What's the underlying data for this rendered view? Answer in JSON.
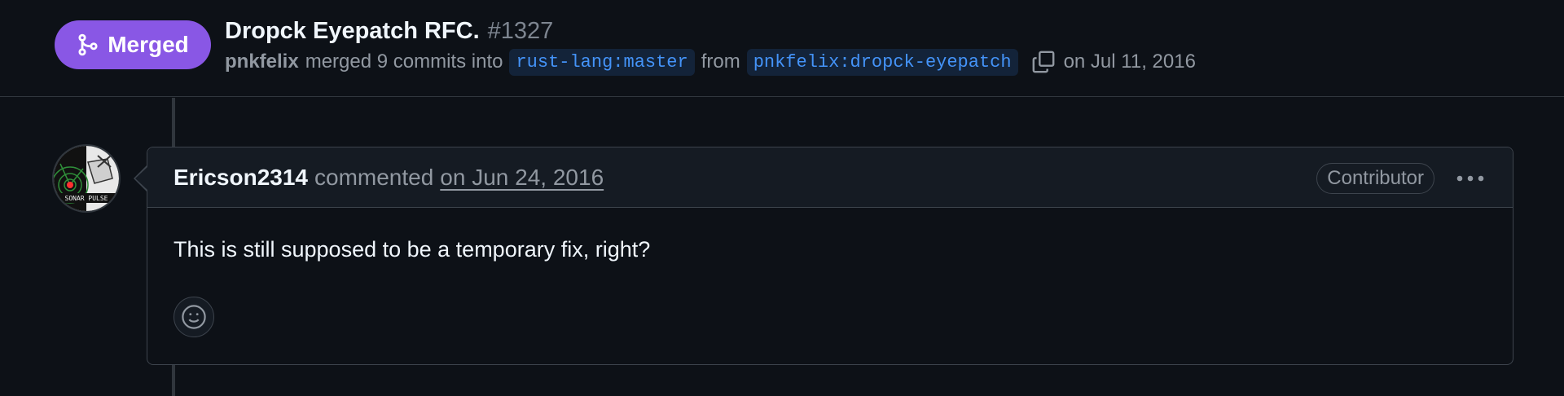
{
  "pr": {
    "state_label": "Merged",
    "title": "Dropck Eyepatch RFC.",
    "number": "#1327",
    "merger": "pnkfelix",
    "merge_text": "merged 9 commits into",
    "base_branch": "rust-lang:master",
    "from_text": "from",
    "head_branch": "pnkfelix:dropck-eyepatch",
    "merged_date": "on Jul 11, 2016"
  },
  "comment": {
    "author": "Ericson2314",
    "action": "commented",
    "date": "on Jun 24, 2016",
    "role": "Contributor",
    "body": "This is still supposed to be a temporary fix, right?"
  },
  "avatar": {
    "text": "SONAR PULSE"
  },
  "icons": {
    "state": "git-merge-icon",
    "copy": "copy-icon",
    "more": "kebab-horizontal-icon",
    "reaction": "smiley-icon"
  },
  "colors": {
    "background": "#0d1117",
    "merged_purple": "#8957e5",
    "link_blue": "#4493f8",
    "muted": "#9198a1",
    "border": "#3d444d"
  }
}
